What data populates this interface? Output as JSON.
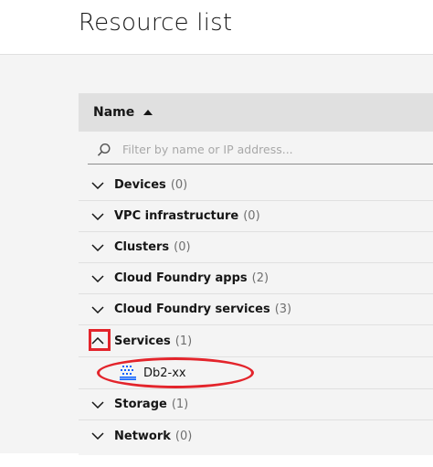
{
  "page": {
    "title": "Resource list"
  },
  "table": {
    "header": {
      "name_label": "Name"
    },
    "search": {
      "placeholder": "Filter by name or IP address..."
    },
    "rows": [
      {
        "label": "Devices",
        "count": "(0)",
        "expanded": false
      },
      {
        "label": "VPC infrastructure",
        "count": "(0)",
        "expanded": false
      },
      {
        "label": "Clusters",
        "count": "(0)",
        "expanded": false
      },
      {
        "label": "Cloud Foundry apps",
        "count": "(2)",
        "expanded": false
      },
      {
        "label": "Cloud Foundry services",
        "count": "(3)",
        "expanded": false
      },
      {
        "label": "Services",
        "count": "(1)",
        "expanded": true
      },
      {
        "label": "Storage",
        "count": "(1)",
        "expanded": false
      },
      {
        "label": "Network",
        "count": "(0)",
        "expanded": false
      }
    ],
    "services_children": [
      {
        "label": "Db2-xx",
        "icon": "db2-icon"
      }
    ]
  },
  "icons": {
    "sort": "sort-ascending-icon",
    "search": "search-icon",
    "collapsed": "chevron-down-icon",
    "expanded": "chevron-up-icon"
  },
  "colors": {
    "annotation": "#e3242b",
    "db2_blue": "#0f62fe"
  }
}
